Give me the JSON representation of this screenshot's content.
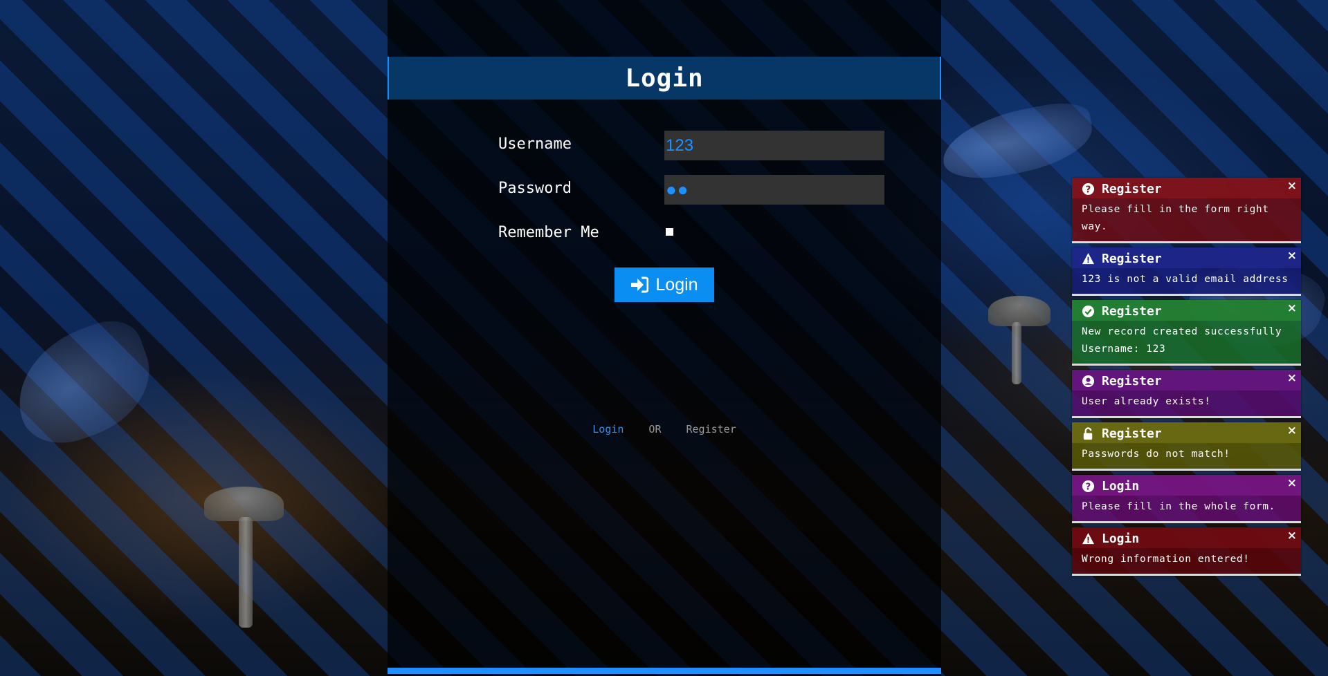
{
  "form": {
    "title": "Login",
    "username_label": "Username",
    "username_value": "123",
    "password_label": "Password",
    "password_masked": "●●",
    "remember_label": "Remember Me",
    "remember_checked": false,
    "submit_label": "Login",
    "submit_icon": "sign-in-icon"
  },
  "switcher": {
    "login": "Login",
    "or": "OR",
    "register": "Register"
  },
  "colors": {
    "accent": "#1f8fff",
    "header": "#073766",
    "input_bg": "#333333",
    "input_text": "#1e90ff"
  },
  "notifications": [
    {
      "title": "Register",
      "message": "Please fill in the form right way.",
      "icon": "question-circle-icon",
      "color": "#82141c"
    },
    {
      "title": "Register",
      "message": "123 is not a valid email address",
      "icon": "warning-triangle-icon",
      "color": "#1e288c"
    },
    {
      "title": "Register",
      "message": "New record created successfully",
      "message2": "Username: 123",
      "icon": "check-circle-icon",
      "color": "#248234"
    },
    {
      "title": "Register",
      "message": "User already exists!",
      "icon": "user-circle-icon",
      "color": "#661880"
    },
    {
      "title": "Register",
      "message": "Passwords do not match!",
      "icon": "unlock-icon",
      "color": "#6c6c14"
    },
    {
      "title": "Login",
      "message": "Please fill in the whole form.",
      "icon": "question-circle-icon",
      "color": "#761882"
    },
    {
      "title": "Login",
      "message": "Wrong information entered!",
      "icon": "warning-triangle-icon",
      "color": "#6e0c12"
    }
  ],
  "close_glyph": "×"
}
